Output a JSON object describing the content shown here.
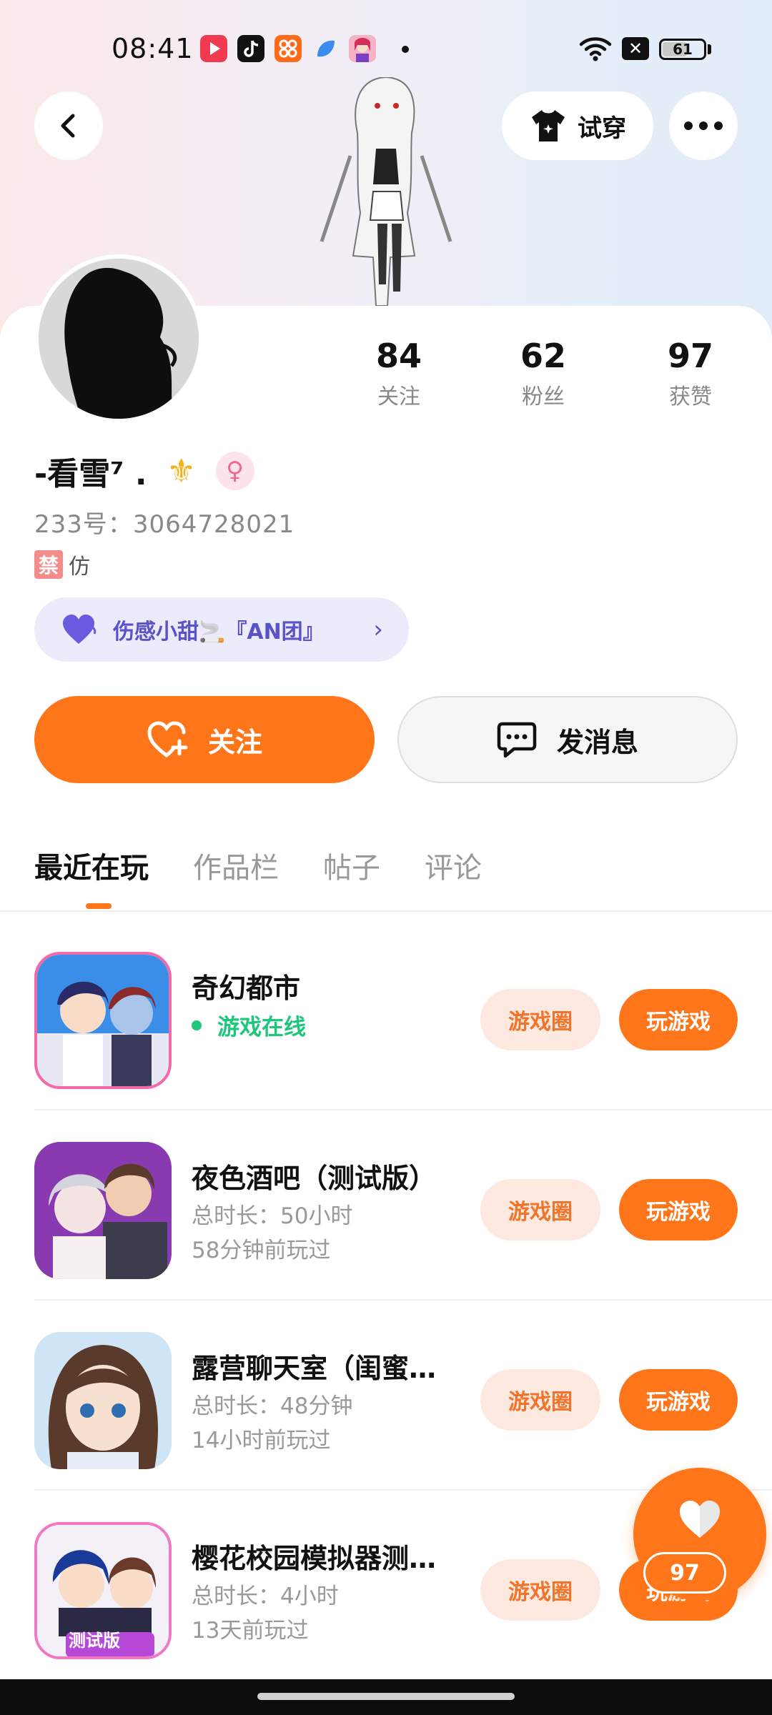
{
  "status_bar": {
    "time": "08:41",
    "battery": "61",
    "battery_fraction": 0.61
  },
  "header": {
    "try_on_label": "试穿"
  },
  "profile": {
    "stats": [
      {
        "value": "84",
        "label": "关注"
      },
      {
        "value": "62",
        "label": "粉丝"
      },
      {
        "value": "97",
        "label": "获赞"
      }
    ],
    "username": "-看雪⁷ .",
    "gender_symbol": "♀",
    "uid": "233号：3064728021",
    "tag_ban": "禁",
    "tag_text": "仿",
    "club_label": "伤感小甜🚬『AN团』",
    "follow_label": "关注",
    "message_label": "发消息"
  },
  "tabs": [
    {
      "label": "最近在玩"
    },
    {
      "label": "作品栏"
    },
    {
      "label": "帖子"
    },
    {
      "label": "评论"
    }
  ],
  "games": [
    {
      "title": "奇幻都市",
      "status": "游戏在线",
      "circle_label": "游戏圈",
      "play_label": "玩游戏"
    },
    {
      "title": "夜色酒吧（测试版）",
      "duration": "总时长：50小时",
      "last_played": "58分钟前玩过",
      "circle_label": "游戏圈",
      "play_label": "玩游戏"
    },
    {
      "title": "露营聊天室（闺蜜…",
      "duration": "总时长：48分钟",
      "last_played": "14小时前玩过",
      "circle_label": "游戏圈",
      "play_label": "玩游戏"
    },
    {
      "title": "樱花校园模拟器测…",
      "duration": "总时长：4小时",
      "last_played": "13天前玩过",
      "circle_label": "游戏圈",
      "play_label": "玩游戏",
      "thumb_badge": "测试版"
    }
  ],
  "floating_like": {
    "count": "97"
  },
  "colors": {
    "accent": "#ff7519",
    "online": "#1ec77a",
    "club": "#5a52c8"
  }
}
